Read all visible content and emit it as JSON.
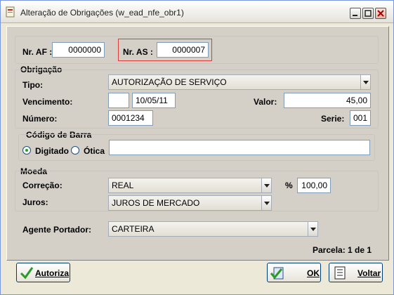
{
  "window": {
    "title": "Alteração de Obrigações (w_ead_nfe_obr1)"
  },
  "header": {
    "nr_af_label": "Nr. AF :",
    "nr_af_value": "0000000",
    "nr_as_label": "Nr. AS :",
    "nr_as_value": "0000007"
  },
  "obrigacao": {
    "section_label": "Obrigação",
    "tipo_label": "Tipo:",
    "tipo_value": "AUTORIZAÇÃO DE SERVIÇO",
    "vencimento_label": "Vencimento:",
    "vencimento_value": "10/05/11",
    "valor_label": "Valor:",
    "valor_value": "45,00",
    "numero_label": "Número:",
    "numero_value": "0001234",
    "serie_label": "Serie:",
    "serie_value": "001"
  },
  "barcode": {
    "section_label": "Código de Barra",
    "option_digitado": "Digitado",
    "option_otica": "Ótica",
    "selected": "Digitado",
    "value": ""
  },
  "moeda": {
    "section_label": "Moeda",
    "correcao_label": "Correção:",
    "correcao_value": "REAL",
    "percent_label": "%",
    "percent_value": "100,00",
    "juros_label": "Juros:",
    "juros_value": "JUROS DE MERCADO"
  },
  "agente": {
    "label": "Agente Portador:",
    "value": "CARTEIRA"
  },
  "parcela": "Parcela: 1 de 1",
  "buttons": {
    "autoriza": "Autoriza",
    "ok": "OK",
    "voltar": "Voltar"
  }
}
